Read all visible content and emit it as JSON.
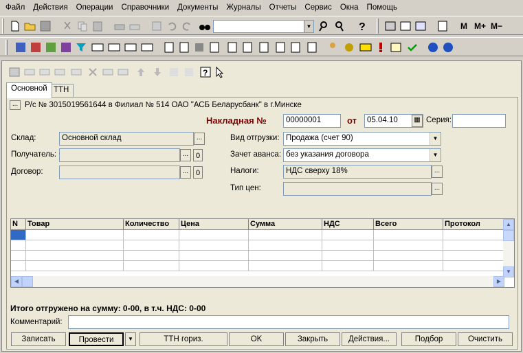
{
  "menu": [
    "Файл",
    "Действия",
    "Операции",
    "Справочники",
    "Документы",
    "Журналы",
    "Отчеты",
    "Сервис",
    "Окна",
    "Помощь"
  ],
  "toolbar": {
    "m": "M",
    "mplus": "M+",
    "mminus": "M−"
  },
  "tabs": [
    "Основной",
    "ТТН"
  ],
  "account_line": "Р/с № 3015019561644 в Филиал № 514 ОАО \"АСБ Беларусбанк\" в г.Минске",
  "header": {
    "title": "Накладная №",
    "number": "00000001",
    "from_label": "от",
    "date": "05.04.10",
    "series_label": "Серия:",
    "series": ""
  },
  "form": {
    "sklad_label": "Склад:",
    "sklad": "Основной склад",
    "poluchatel_label": "Получатель:",
    "poluchatel": "",
    "dogovor_label": "Договор:",
    "dogovor": "",
    "vid_label": "Вид отгрузки:",
    "vid": "Продажа (счет 90)",
    "zachet_label": "Зачет аванса:",
    "zachet": "без указания договора",
    "nalogi_label": "Налоги:",
    "nalogi": "НДС сверху 18%",
    "tipcen_label": "Тип цен:",
    "tipcen": ""
  },
  "table": {
    "columns": [
      "N",
      "Товар",
      "Количество",
      "Цена",
      "Сумма",
      "НДС",
      "Всего",
      "Протокол"
    ]
  },
  "total": "Итого отгружено на сумму: 0-00, в т.ч. НДС: 0-00",
  "comment_label": "Комментарий:",
  "comment": "",
  "buttons": [
    "Записать",
    "Провести",
    "ТТН гориз.",
    "OK",
    "Закрыть",
    "Действия...",
    "Подбор",
    "Очистить"
  ]
}
